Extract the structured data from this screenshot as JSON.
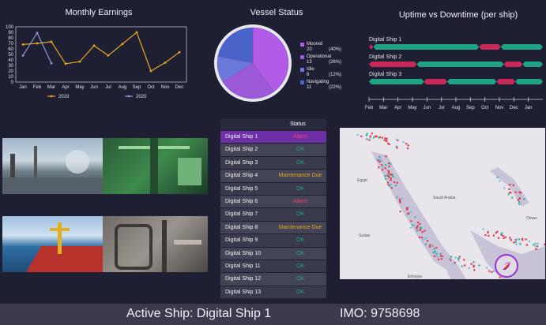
{
  "earnings": {
    "title": "Monthly Earnings",
    "yticks": [
      "100",
      "90",
      "80",
      "70",
      "60",
      "50",
      "40",
      "30",
      "20",
      "10",
      "0"
    ],
    "months": [
      "Jan",
      "Feb",
      "Mar",
      "Apr",
      "May",
      "Jun",
      "Jul",
      "Aug",
      "Sep",
      "Oct",
      "Nov",
      "Dec"
    ],
    "series": [
      {
        "name": "2019",
        "color": "#e6a820",
        "values": [
          68,
          70,
          73,
          33,
          37,
          66,
          48,
          69,
          90,
          20,
          35,
          54
        ]
      },
      {
        "name": "2020",
        "color": "#8899dd",
        "values": [
          48,
          89,
          34
        ]
      }
    ],
    "ylim": [
      0,
      100
    ]
  },
  "vessel": {
    "title": "Vessel Status",
    "slices": [
      {
        "label": "Moored",
        "count": "20",
        "pct": "(40%)",
        "value": 40,
        "color": "#b25be6"
      },
      {
        "label": "Operational",
        "count": "13",
        "pct": "(26%)",
        "value": 26,
        "color": "#9b59d8"
      },
      {
        "label": "Idle",
        "count": "6",
        "pct": "(12%)",
        "value": 12,
        "color": "#6a78d8"
      },
      {
        "label": "Navigating",
        "count": "11",
        "pct": "(22%)",
        "value": 22,
        "color": "#4a63c8"
      }
    ]
  },
  "uptime": {
    "title": "Uptime vs Downtime (per ship)",
    "months": [
      "Feb",
      "Mar",
      "Apr",
      "May",
      "Jun",
      "Jul",
      "Aug",
      "Sep",
      "Oct",
      "Nov",
      "Dec",
      "Jan"
    ],
    "up_color": "#1fa383",
    "down_color": "#c8285a",
    "ships": [
      {
        "name": "Digital Ship 1",
        "segments": [
          [
            "down",
            0,
            0.3
          ],
          [
            "up",
            0.3,
            7.6
          ],
          [
            "down",
            7.6,
            9.1
          ],
          [
            "up",
            9.1,
            12
          ]
        ]
      },
      {
        "name": "Digital Ship 2",
        "segments": [
          [
            "down",
            0,
            3.3
          ],
          [
            "up",
            3.3,
            9.3
          ],
          [
            "down",
            9.3,
            10.6
          ],
          [
            "up",
            10.6,
            12
          ]
        ]
      },
      {
        "name": "Digital Ship 3",
        "segments": [
          [
            "up",
            0,
            3.8
          ],
          [
            "down",
            3.8,
            5.4
          ],
          [
            "up",
            5.4,
            8.8
          ],
          [
            "down",
            8.8,
            10.1
          ],
          [
            "up",
            10.1,
            12
          ]
        ]
      }
    ]
  },
  "status_table": {
    "header": "Status",
    "rows": [
      {
        "name": "Digital Ship 1",
        "status": "Alarm",
        "color": "#ff3b6e",
        "active": true
      },
      {
        "name": "Digital Ship 2",
        "status": "OK",
        "color": "#1fa383"
      },
      {
        "name": "Digital Ship 3",
        "status": "OK",
        "color": "#1fa383"
      },
      {
        "name": "Digital Ship 4",
        "status": "Maintenance Due",
        "color": "#e6a820"
      },
      {
        "name": "Digital Ship 5",
        "status": "OK",
        "color": "#1fa383"
      },
      {
        "name": "Digital Ship 6",
        "status": "Alarm",
        "color": "#ff3b6e"
      },
      {
        "name": "Digital Ship 7",
        "status": "OK",
        "color": "#1fa383"
      },
      {
        "name": "Digital Ship 8",
        "status": "Maintenance Due",
        "color": "#e6a820"
      },
      {
        "name": "Digital Ship 9",
        "status": "OK",
        "color": "#1fa383"
      },
      {
        "name": "Digital Ship 10",
        "status": "OK",
        "color": "#1fa383"
      },
      {
        "name": "Digital Ship 11",
        "status": "OK",
        "color": "#1fa383"
      },
      {
        "name": "Digital Ship 12",
        "status": "OK",
        "color": "#1fa383"
      },
      {
        "name": "Digital Ship 13",
        "status": "OK",
        "color": "#1fa383"
      }
    ]
  },
  "map": {
    "labels": {
      "egypt": "Egypt",
      "saudi": "Saudi Arabia",
      "sudan": "Sudan",
      "oman": "Oman",
      "ethiopia": "Ethiopia"
    },
    "compass_icon": "rocket-icon"
  },
  "footer": {
    "active_ship": "Active Ship: Digital Ship 1",
    "imo": "IMO: 9758698"
  }
}
